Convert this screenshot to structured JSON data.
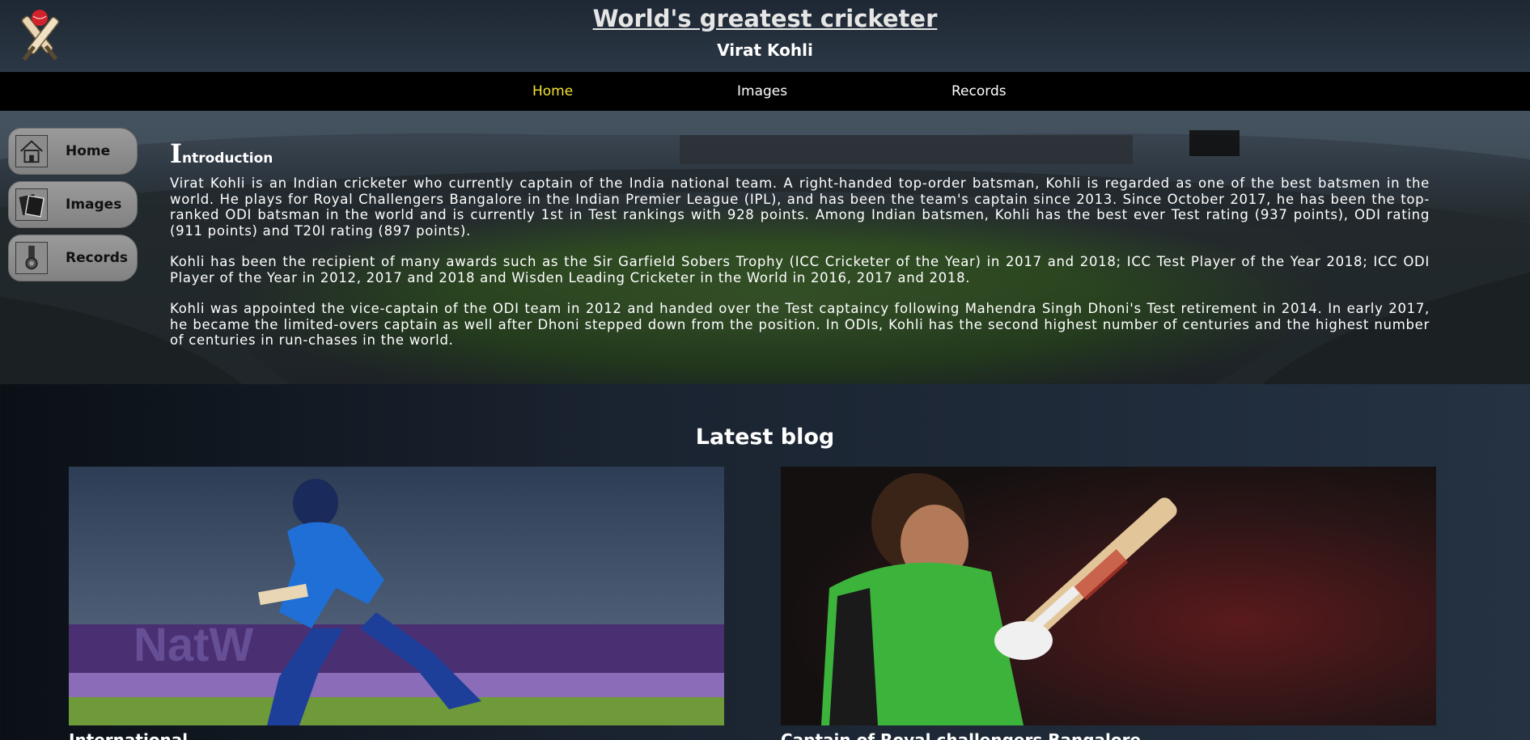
{
  "header": {
    "title": "World's greatest cricketer",
    "subtitle": "Virat Kohli",
    "logo_icon": "cricket-bats-ball-icon"
  },
  "nav": {
    "items": [
      {
        "label": "Home",
        "active": true
      },
      {
        "label": "Images",
        "active": false
      },
      {
        "label": "Records",
        "active": false
      }
    ],
    "active_color": "#f5e431"
  },
  "sidebar": {
    "items": [
      {
        "label": "Home",
        "icon": "home-icon"
      },
      {
        "label": "Images",
        "icon": "images-icon"
      },
      {
        "label": "Records",
        "icon": "medal-icon"
      }
    ]
  },
  "intro": {
    "heading_cap": "I",
    "heading_rest": "ntroduction",
    "paragraphs": [
      "Virat Kohli is an Indian cricketer who currently captain of the India national team. A right-handed top-order batsman, Kohli is regarded as one of the best batsmen in the world. He plays for Royal Challengers Bangalore in the Indian Premier League (IPL), and has been the team's captain since 2013. Since October 2017, he has been the top-ranked ODI batsman in the world and is currently 1st in Test rankings with 928 points. Among Indian batsmen, Kohli has the best ever Test rating (937 points), ODI rating (911 points) and T20I rating (897 points).",
      "Kohli has been the recipient of many awards such as the Sir Garfield Sobers Trophy (ICC Cricketer of the Year) in 2017 and 2018; ICC Test Player of the Year 2018; ICC ODI Player of the Year in 2012, 2017 and 2018 and Wisden Leading Cricketer in the World in 2016, 2017 and 2018.",
      "Kohli was appointed the vice-captain of the ODI team in 2012 and handed over the Test captaincy following Mahendra Singh Dhoni's Test retirement in 2014. In early 2017, he became the limited-overs captain as well after Dhoni stepped down from the position. In ODIs, Kohli has the second highest number of centuries and the highest number of centuries in run-chases in the world."
    ]
  },
  "blog": {
    "title": "Latest blog",
    "cards": [
      {
        "image": "kohli-batting-india-photo",
        "caption": "International"
      },
      {
        "image": "kohli-celebrating-rcb-photo",
        "caption": "Captain of Royal challengers Bangalore"
      }
    ]
  }
}
